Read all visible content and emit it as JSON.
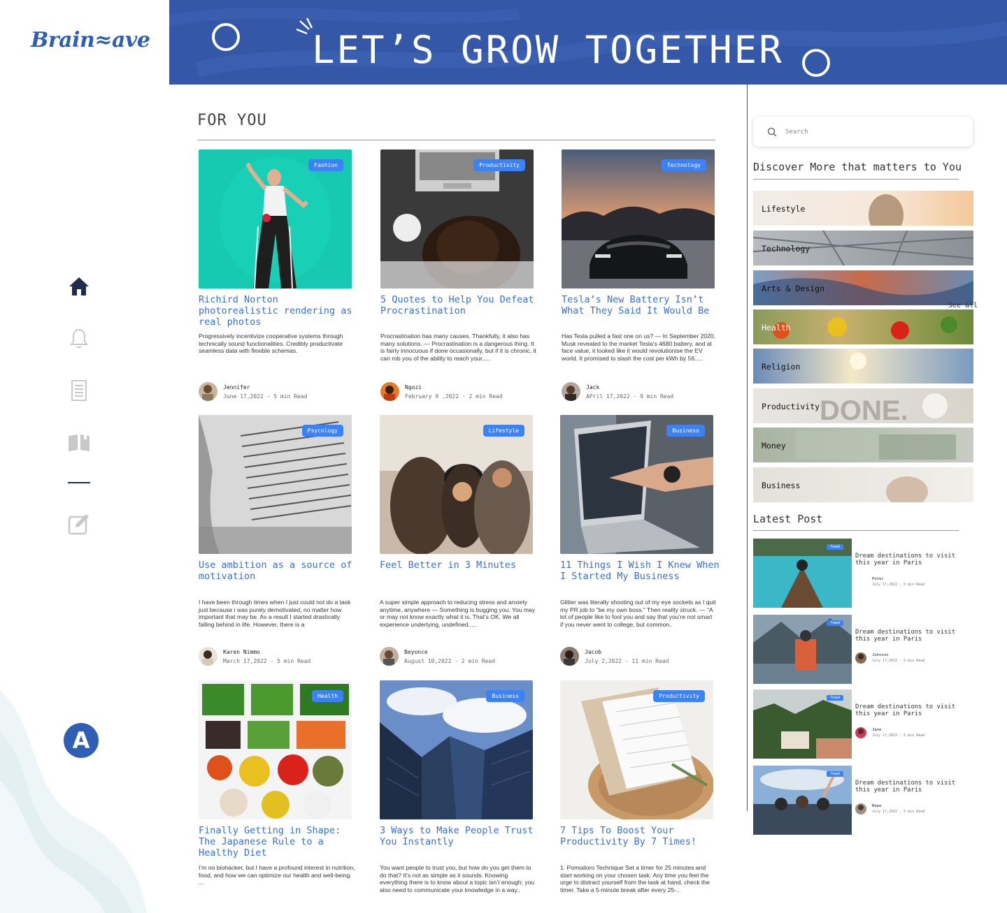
{
  "brand": {
    "logo_text": "Brain≈ave"
  },
  "banner": {
    "title": "LET’S GROW TOGETHER"
  },
  "nav": {
    "items": [
      {
        "icon": "home-icon"
      },
      {
        "icon": "bell-icon"
      },
      {
        "icon": "document-icon"
      },
      {
        "icon": "book-icon"
      },
      {
        "icon": "edit-icon"
      }
    ],
    "profile_initial": "A"
  },
  "main": {
    "section_title": "FOR YOU",
    "posts": [
      {
        "tag": "Fashion",
        "title": "Richird Norton photorealistic rendering as real photos",
        "excerpt": "Progressively incentivize cooperative systems through technically sound functionalities. Credibly productivate seamless data with flexible schemas.",
        "author": "Jennifer",
        "meta": "June 17,2022 - 5 min Read"
      },
      {
        "tag": "Productivity",
        "title": "5 Quotes to Help You Defeat Procrastination",
        "excerpt": "Procrastination has many causes. Thankfully, it also has many solutions. — Procrastination is a dangerous thing. It is fairly innocuous if done occasionally, but if it is chronic, it can rob you of the ability to reach your.....",
        "author": "Ngozi",
        "meta": "February 9 ,2022 - 2 min Read"
      },
      {
        "tag": "Technology",
        "title": "Tesla’s New Battery Isn’t What They Said It Would Be",
        "excerpt": "Has Tesla pulled a fast one on us? — In September 2020, Musk revealed to the market Tesla’s 4680 battery, and at face value, it looked like it would revolutionise the EV world. It promised to slash the cost per kWh by 56.....",
        "author": "Jack",
        "meta": "APril 17,2022 - 9 min Read"
      },
      {
        "tag": "Psycology",
        "title": "Use ambition as a source of motivation",
        "excerpt": "I have been through times when I just could not do a task just because i was purely demotivated, no matter how important that may be. As a result I started drastically falling behind in life. However, there is a",
        "author": "Karen Nimmo",
        "meta": "March 17,2022 - 5 min Read"
      },
      {
        "tag": "Lifestyle",
        "title": "Feel Better in 3 Minutes",
        "excerpt": "A super simple approach to reducing stress and anxiety anytime, anywhere — Something is bugging you. You may or may not know exactly what it is. That’s OK. We all experience underlying, undefined.....",
        "author": "Beyonce",
        "meta": "August 10,2022 - 2 min Read"
      },
      {
        "tag": "Business",
        "title": "11 Things I Wish I Knew When I Started My Business",
        "excerpt": "Glitter was literally shooting out of my eye sockets as I quit my PR job to “be my own boss.” Then reality struck. — “A lot of people like to fool you and say that you’re not smart if you never went to college, but common..",
        "author": "Jacob",
        "meta": "July 2,2022 - 11 min Read"
      },
      {
        "tag": "Health",
        "title": "Finally Getting in Shape: The Japanese Rule to a Healthy Diet",
        "excerpt": "I’m no biohacker, but I have a profound interest in nutrition, food, and how we can optimize our health and well-being. ...",
        "author": "",
        "meta": ""
      },
      {
        "tag": "Business",
        "title": "3 Ways to Make People Trust You Instantly",
        "excerpt": "You want people to trust you, but how do you get them to do that? It’s not as simple as it sounds. Knowing everything there is to know about a topic isn’t enough; you also need to communicate your knowledge in a way..",
        "author": "",
        "meta": ""
      },
      {
        "tag": "Productivity",
        "title": "7 Tips To Boost Your Productivity By 7 Times!",
        "excerpt": "1. Pomodoro Technique Set a timer for 25 minutes and start working on your chosen task. Any time you feel the urge to distract yourself from the task at hand, check the timer. Take a 5-minute break after every 25-..",
        "author": "",
        "meta": ""
      }
    ]
  },
  "right": {
    "search_placeholder": "Search",
    "discover_title": "Discover More that matters to You",
    "see_all": "See all",
    "topics": [
      "Lifestyle",
      "Technology",
      "Arts & Design",
      "Health",
      "Religion",
      "Productivity",
      "Money",
      "Business"
    ],
    "latest_title": "Latest Post",
    "latest_posts": [
      {
        "tag": "Travel",
        "title": "Dream destinations to visit this year in Paris",
        "author": "Peter",
        "meta": "July 17,2022 - 5 min Read"
      },
      {
        "tag": "Travel",
        "title": "Dream destinations to visit this year in Paris",
        "author": "Johnson",
        "meta": "July 17,2022 - 5 min Read"
      },
      {
        "tag": "Travel",
        "title": "Dream destinations to visit this year in Paris",
        "author": "Jane",
        "meta": "July 17,2022 - 5 min Read"
      },
      {
        "tag": "Travel",
        "title": "Dream destinations to visit this year in Paris",
        "author": "Bepe",
        "meta": "July 17,2022 - 5 min Read"
      }
    ]
  },
  "colors": {
    "accent": "#3457a8",
    "tag": "#3b82f6",
    "link": "#3a6fc9"
  }
}
